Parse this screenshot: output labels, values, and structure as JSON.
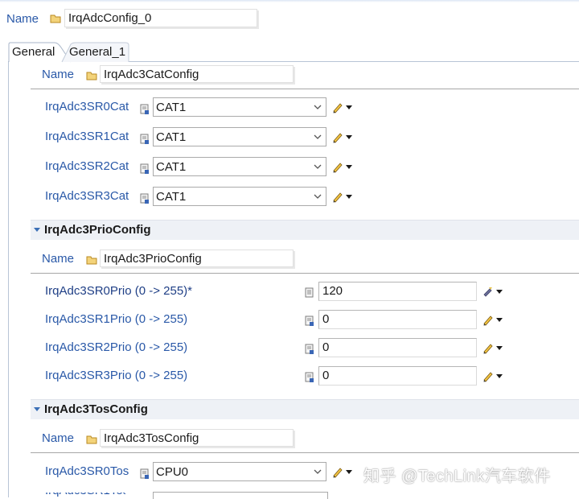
{
  "top": {
    "name_label": "Name",
    "name_value": "IrqAdcConfig_0"
  },
  "tabs": [
    {
      "label": "General"
    },
    {
      "label": "General_1"
    }
  ],
  "cat_section": {
    "name_label": "Name",
    "name_value": "IrqAdc3CatConfig",
    "rows": [
      {
        "label": "IrqAdc3SR0Cat",
        "value": "CAT1"
      },
      {
        "label": "IrqAdc3SR1Cat",
        "value": "CAT1"
      },
      {
        "label": "IrqAdc3SR2Cat",
        "value": "CAT1"
      },
      {
        "label": "IrqAdc3SR3Cat",
        "value": "CAT1"
      }
    ]
  },
  "prio_section": {
    "title": "IrqAdc3PrioConfig",
    "name_label": "Name",
    "name_value": "IrqAdc3PrioConfig",
    "rows": [
      {
        "label": "IrqAdc3SR0Prio (0 -> 255)*",
        "value": "120"
      },
      {
        "label": "IrqAdc3SR1Prio (0 -> 255)",
        "value": "0"
      },
      {
        "label": "IrqAdc3SR2Prio (0 -> 255)",
        "value": "0"
      },
      {
        "label": "IrqAdc3SR3Prio (0 -> 255)",
        "value": "0"
      }
    ]
  },
  "tos_section": {
    "title": "IrqAdc3TosConfig",
    "name_label": "Name",
    "name_value": "IrqAdc3TosConfig",
    "rows": [
      {
        "label": "IrqAdc3SR0Tos",
        "value": "CPU0"
      }
    ]
  },
  "watermark": "知乎 @TechLink汽车软件",
  "icons": {
    "folder": "folder-icon",
    "field_type": "field-type-icon",
    "edit": "pencil-icon",
    "dropdown": "chevron-down-icon"
  }
}
